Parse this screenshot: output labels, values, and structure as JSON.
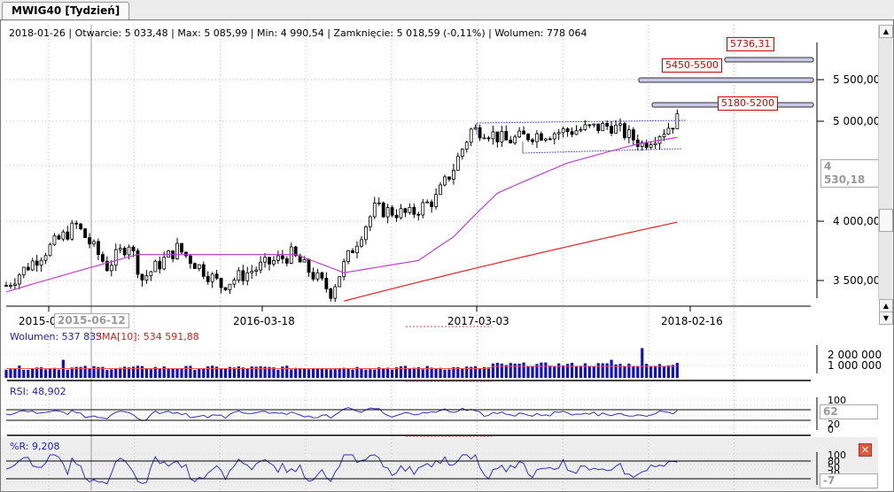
{
  "tab": {
    "title": "MWIG40 [Tydzień]"
  },
  "header": {
    "info": "2018-01-26 | Otwarcie: 5 033,48 | Max: 5 085,99 | Min: 4 990,54 | Zamknięcie: 5 018,59 (-0,11%)  | Wolumen: 778 064"
  },
  "price_axis": {
    "ticks": [
      "5 500,00",
      "5 000,00",
      "4 000,00",
      "3 500,00"
    ],
    "current": "4 530,18"
  },
  "levels": [
    {
      "label": "5736,31",
      "value": 5736
    },
    {
      "label": "5450-5500",
      "value": 5475
    },
    {
      "label": "5180-5200",
      "value": 5190
    }
  ],
  "x_axis": {
    "labels": [
      "2015-0",
      "2016-03-18",
      "2017-03-03",
      "2018-02-16"
    ],
    "cursor": "2015-06-12"
  },
  "volume": {
    "label": "Wolumen: 537 833",
    "sma_label": "SMA[10]: 534 591,88",
    "ticks": [
      "2 000 000",
      "1 000 000"
    ]
  },
  "rsi": {
    "label": "RSI: 48,902",
    "ticks": [
      "100",
      "20",
      "0"
    ],
    "current": "62"
  },
  "wr": {
    "label": "%R: 9,208",
    "ticks": [
      "100",
      "80",
      "50",
      "20"
    ],
    "current": "-7"
  },
  "colors": {
    "bull": "#000000",
    "sma_fast": "#c040d0",
    "sma_slow": "#e02020",
    "volume": "#1010c0",
    "indicator": "#3030c0",
    "label_red": "#cc0000"
  },
  "chart_data": {
    "type": "candlestick",
    "scale": "log",
    "ylim": [
      3300,
      5900
    ],
    "close_keypoints": [
      [
        0,
        3450
      ],
      [
        16,
        3950
      ],
      [
        23,
        3600
      ],
      [
        28,
        3800
      ],
      [
        31,
        3500
      ],
      [
        39,
        3750
      ],
      [
        49,
        3450
      ],
      [
        58,
        3600
      ],
      [
        65,
        3700
      ],
      [
        74,
        3400
      ],
      [
        79,
        3750
      ],
      [
        84,
        4100
      ],
      [
        92,
        4050
      ],
      [
        98,
        4200
      ],
      [
        102,
        4500
      ],
      [
        106,
        4900
      ],
      [
        109,
        4900
      ],
      [
        114,
        4780
      ],
      [
        120,
        4850
      ],
      [
        130,
        4900
      ],
      [
        138,
        4950
      ],
      [
        145,
        4750
      ],
      [
        150,
        4900
      ],
      [
        153,
        5020
      ]
    ],
    "sma_fast": [
      [
        0,
        3400
      ],
      [
        30,
        3700
      ],
      [
        66,
        3700
      ],
      [
        77,
        3550
      ],
      [
        94,
        3650
      ],
      [
        102,
        3850
      ],
      [
        112,
        4250
      ],
      [
        128,
        4550
      ],
      [
        144,
        4750
      ],
      [
        153,
        4820
      ]
    ],
    "sma_slow": [
      [
        77,
        3330
      ],
      [
        153,
        3980
      ]
    ]
  }
}
